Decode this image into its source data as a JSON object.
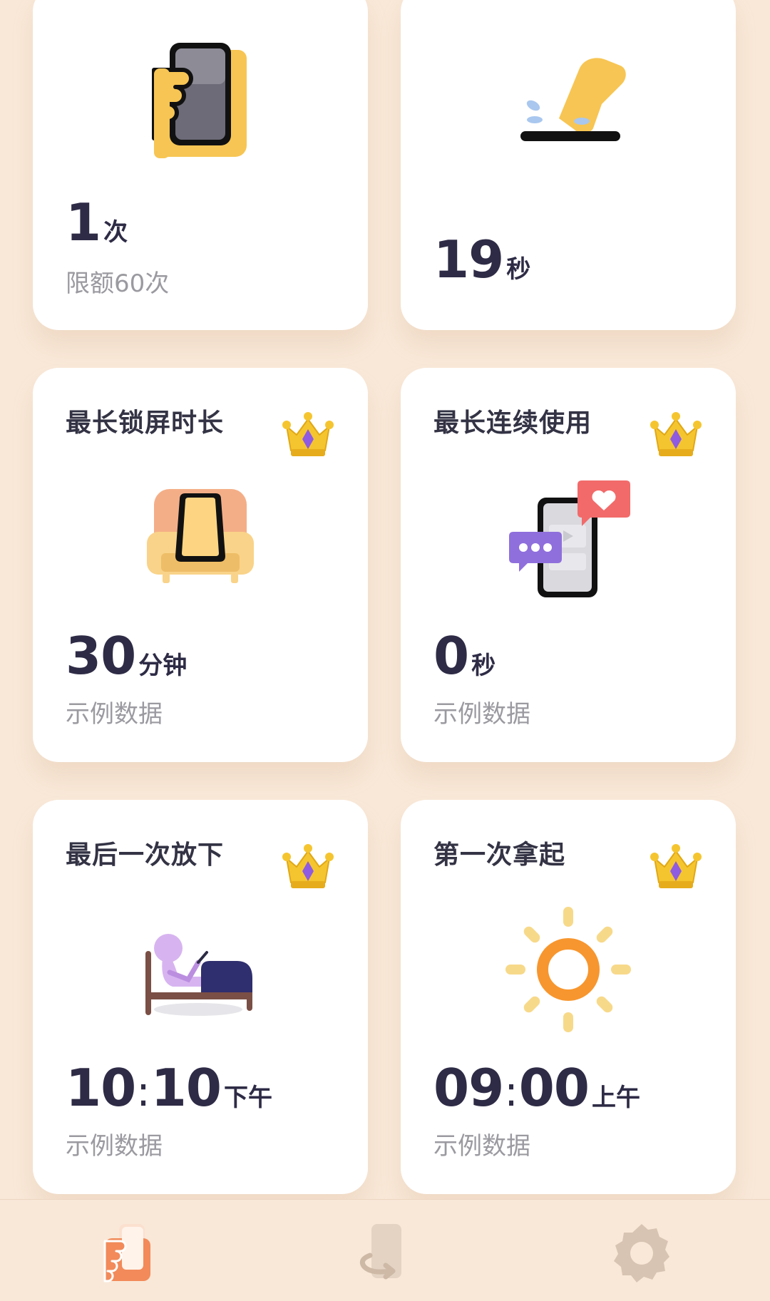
{
  "colors": {
    "background": "#f9e8d8",
    "card": "#ffffff",
    "value_text": "#2e2b46",
    "sub_text": "#9a9aa0",
    "tab_active": "#f28a5a",
    "tab_inactive": "#d8c4b2"
  },
  "cards": {
    "pickups": {
      "icon": "hand-holding-phone-icon",
      "value": "1",
      "unit": "次",
      "subtext": "限额60次"
    },
    "tap": {
      "icon": "finger-tap-icon",
      "value": "19",
      "unit": "秒"
    },
    "lock": {
      "title": "最长锁屏时长",
      "icon": "phone-on-sofa-icon",
      "value": "30",
      "unit": "分钟",
      "subtext": "示例数据",
      "badge": "crown-icon"
    },
    "continuous": {
      "title": "最长连续使用",
      "icon": "phone-chat-icon",
      "value": "0",
      "unit": "秒",
      "subtext": "示例数据",
      "badge": "crown-icon"
    },
    "last_putdown": {
      "title": "最后一次放下",
      "icon": "person-in-bed-icon",
      "hour": "10",
      "minute": "10",
      "separator": ":",
      "period": "下午",
      "subtext": "示例数据",
      "badge": "crown-icon"
    },
    "first_pickup": {
      "title": "第一次拿起",
      "icon": "sun-icon",
      "hour": "09",
      "minute": "00",
      "separator": ":",
      "period": "上午",
      "subtext": "示例数据",
      "badge": "crown-icon"
    }
  },
  "tabbar": {
    "tabs": [
      {
        "icon": "phone-hand-tab-icon",
        "active": true
      },
      {
        "icon": "phone-rotate-tab-icon",
        "active": false
      },
      {
        "icon": "gear-icon",
        "active": false
      }
    ]
  }
}
